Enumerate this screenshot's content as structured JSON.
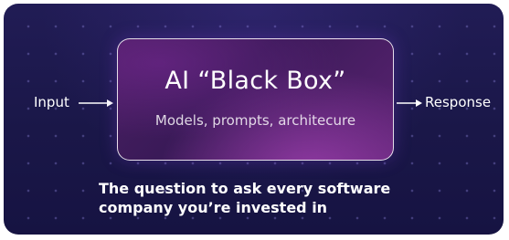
{
  "diagram": {
    "input_label": "Input",
    "box_title": "AI “Black Box”",
    "box_subtitle": "Models, prompts, architecure",
    "output_label": "Response"
  },
  "caption": {
    "line1": "The question to ask every software",
    "line2": "company you’re invested in"
  },
  "colors": {
    "background": "#1a1748",
    "box_fill": "#3a1a58",
    "box_border": "#ffffff",
    "text": "#ffffff"
  }
}
